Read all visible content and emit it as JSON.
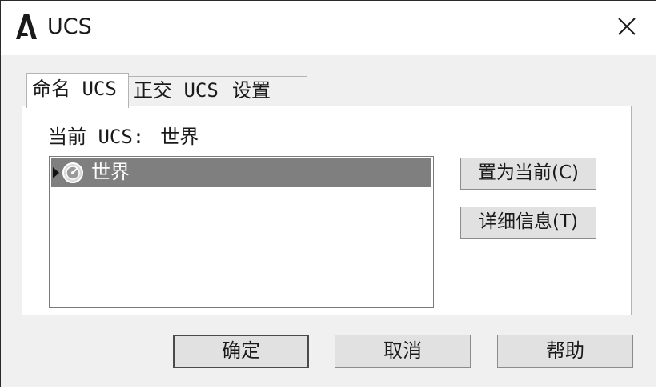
{
  "window": {
    "title": "UCS",
    "logo_icon": "autocad-a-logo",
    "close_icon": "close-x"
  },
  "tabs": [
    {
      "label": "命名 UCS",
      "active": true
    },
    {
      "label": "正交 UCS",
      "active": false
    },
    {
      "label": "设置",
      "active": false
    }
  ],
  "named_ucs": {
    "current_label": "当前 UCS:",
    "current_value": "世界",
    "list": [
      {
        "label": "世界",
        "icon": "globe-icon",
        "selected": true,
        "expandable": true
      }
    ]
  },
  "side_buttons": {
    "set_current": "置为当前(C)",
    "details": "详细信息(T)"
  },
  "footer": {
    "ok": "确定",
    "cancel": "取消",
    "help": "帮助"
  },
  "colors": {
    "selection": "#7f7f7f",
    "button_face": "#e1e1e1",
    "dialog_bg": "#f0f0f0"
  }
}
